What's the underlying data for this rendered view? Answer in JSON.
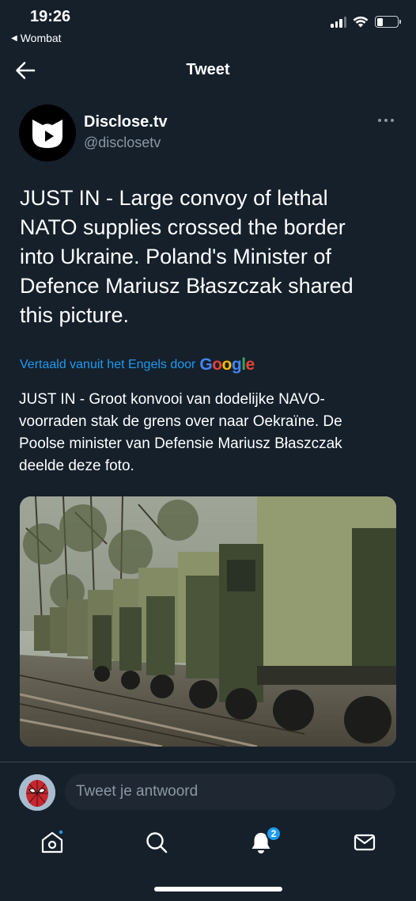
{
  "status_bar": {
    "time": "19:26",
    "back_app": "Wombat"
  },
  "header": {
    "title": "Tweet"
  },
  "tweet": {
    "author_name": "Disclose.tv",
    "author_handle": "@disclosetv",
    "text": "JUST IN - Large convoy of lethal NATO supplies crossed the border into Ukraine. Poland's Minister of Defence Mariusz Błaszczak shared this picture.",
    "translated_label": "Vertaald vanuit het Engels door",
    "translation": "JUST IN - Groot konvooi van dodelijke NAVO-voorraden stak de grens over naar Oekraïne. De Poolse minister van Defensie Mariusz Błaszczak deelde deze foto.",
    "photo_subject": "military trucks convoy on railway by forest"
  },
  "reply": {
    "placeholder": "Tweet je antwoord"
  },
  "tabbar": {
    "items": [
      "home-icon",
      "search-icon",
      "notifications-icon",
      "messages-icon"
    ],
    "notifications_badge": "2"
  },
  "colors": {
    "background": "#15202b",
    "accent": "#1d9bf0",
    "secondary_text": "#8b98a5"
  }
}
